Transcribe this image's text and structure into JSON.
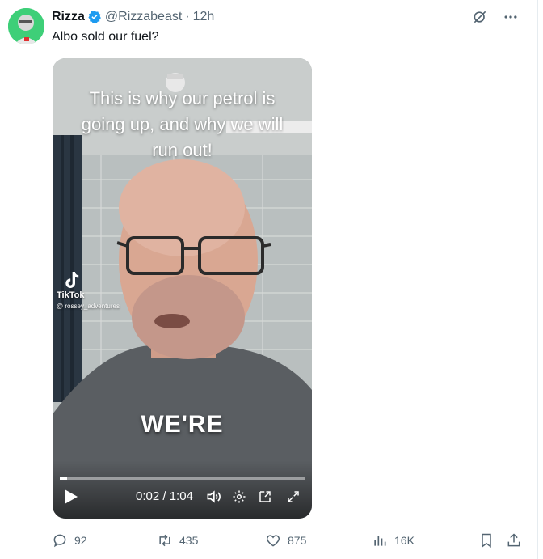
{
  "tweet": {
    "author_name": "Rizza",
    "handle": "@Rizzabeast",
    "separator": "·",
    "time": "12h",
    "text": "Albo sold our fuel?",
    "header_icons": [
      "grok-icon",
      "more-icon"
    ]
  },
  "video": {
    "caption_lines": [
      "This is why our petrol is",
      "going up, and why we will",
      "run out!"
    ],
    "watermark_brand": "TikTok",
    "watermark_user": "@ rossey_adventures",
    "subtitle": "WE'RE",
    "current_time": "0:02",
    "duration": "1:04",
    "time_readout": "0:02 / 1:04",
    "progress_fraction": 0.03,
    "control_icons": [
      "play-icon",
      "volume-icon",
      "settings-icon",
      "pop-out-icon",
      "fullscreen-icon"
    ]
  },
  "actions": {
    "replies": "92",
    "reposts": "435",
    "likes": "875",
    "views": "16K"
  },
  "colors": {
    "accent": "#1d9bf0",
    "secondary_text": "#536471",
    "primary_text": "#0f1419",
    "avatar_bg": "#3ecf78"
  }
}
